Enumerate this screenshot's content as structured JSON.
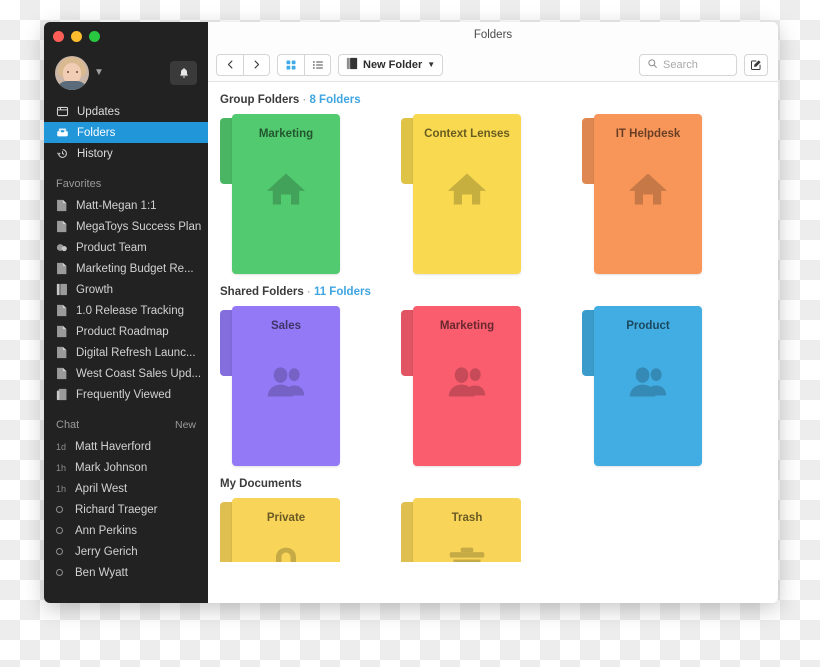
{
  "window": {
    "title": "Folders",
    "traffic_lights": [
      "close",
      "minimize",
      "maximize"
    ]
  },
  "sidebar": {
    "profile": {
      "chevron": "chevron-down-icon",
      "notifications": "bell-icon"
    },
    "nav": [
      {
        "label": "Updates",
        "icon": "updates-icon",
        "active": false
      },
      {
        "label": "Folders",
        "icon": "folders-icon",
        "active": true
      },
      {
        "label": "History",
        "icon": "history-icon",
        "active": false
      }
    ],
    "favorites_label": "Favorites",
    "favorites": [
      {
        "label": "Matt-Megan 1:1",
        "icon": "document-icon"
      },
      {
        "label": "MegaToys Success Plan",
        "icon": "document-icon"
      },
      {
        "label": "Product Team",
        "icon": "team-icon"
      },
      {
        "label": "Marketing Budget Re...",
        "icon": "document-icon"
      },
      {
        "label": "Growth",
        "icon": "binder-icon"
      },
      {
        "label": "1.0 Release Tracking",
        "icon": "document-icon"
      },
      {
        "label": "Product Roadmap",
        "icon": "document-icon"
      },
      {
        "label": "Digital Refresh Launc...",
        "icon": "document-icon"
      },
      {
        "label": "West Coast Sales Upd...",
        "icon": "document-icon"
      },
      {
        "label": "Frequently Viewed",
        "icon": "stack-icon"
      }
    ],
    "chat_label": "Chat",
    "chat_new": "New",
    "chat": [
      {
        "time": "1d",
        "name": "Matt Haverford"
      },
      {
        "time": "1h",
        "name": "Mark Johnson"
      },
      {
        "time": "1h",
        "name": "April West"
      },
      {
        "time": "",
        "name": "Richard Traeger"
      },
      {
        "time": "",
        "name": "Ann Perkins"
      },
      {
        "time": "",
        "name": "Jerry Gerich"
      },
      {
        "time": "",
        "name": "Ben Wyatt"
      }
    ]
  },
  "toolbar": {
    "back": "chevron-left-icon",
    "forward": "chevron-right-icon",
    "grid_view": "grid-view-icon",
    "list_view": "list-view-icon",
    "new_folder_label": "New Folder",
    "new_folder_caret": "caret-down-icon",
    "search_placeholder": "Search",
    "search_value": "",
    "search_icon": "search-icon",
    "compose": "compose-icon"
  },
  "sections": [
    {
      "title": "Group Folders",
      "separator": "·",
      "count": "8 Folders",
      "folders": [
        {
          "name": "Marketing",
          "color": "#52ca6f",
          "glyph": "home-icon"
        },
        {
          "name": "Context Lenses",
          "color": "#f8d94f",
          "glyph": "home-icon"
        },
        {
          "name": "IT Helpdesk",
          "color": "#f89659",
          "glyph": "home-icon"
        }
      ]
    },
    {
      "title": "Shared Folders",
      "separator": "·",
      "count": "11 Folders",
      "folders": [
        {
          "name": "Sales",
          "color": "#9379f6",
          "glyph": "people-icon"
        },
        {
          "name": "Marketing",
          "color": "#f95d6e",
          "glyph": "people-icon"
        },
        {
          "name": "Product",
          "color": "#42ade2",
          "glyph": "people-icon"
        }
      ]
    },
    {
      "title": "My Documents",
      "separator": "",
      "count": "",
      "folders": [
        {
          "name": "Private",
          "color": "#f8d458",
          "glyph": "lock-icon"
        },
        {
          "name": "Trash",
          "color": "#f8d458",
          "glyph": "trash-icon"
        }
      ]
    }
  ],
  "colors": {
    "accent": "#2196d9",
    "link": "#3ea5e0",
    "sidebar_bg": "#222222",
    "window_bg": "#ffffff"
  }
}
